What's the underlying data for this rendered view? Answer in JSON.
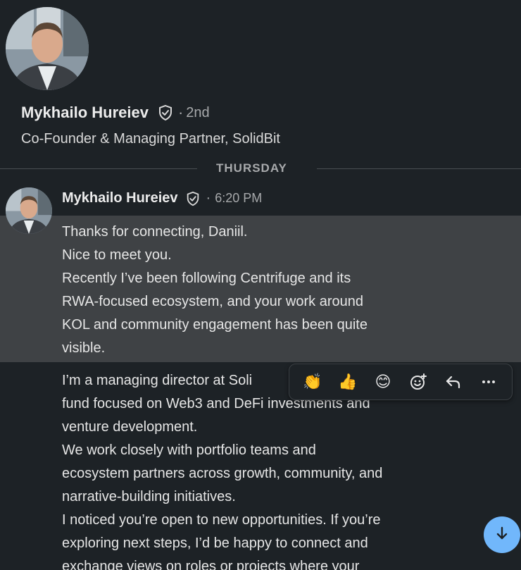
{
  "profile": {
    "name": "Mykhailo Hureiev",
    "degree_sep": "·",
    "degree": "2nd",
    "headline": "Co-Founder & Managing Partner, SolidBit"
  },
  "date_divider": "THURSDAY",
  "message": {
    "sender": "Mykhailo Hureiev",
    "separator": "·",
    "time": "6:20 PM",
    "highlighted_lines": [
      "Thanks for connecting, Daniil.",
      "Nice to meet you.",
      "Recently I’ve been following Centrifuge and its",
      "RWA-focused ecosystem, and your work around",
      "KOL and community engagement has been quite",
      "visible."
    ],
    "body_lines": [
      "I’m a managing director at Soli",
      "fund focused on Web3 and DeFi investments and",
      "venture development.",
      "We work closely with portfolio teams and",
      "ecosystem partners across growth, community, and",
      "narrative-building initiatives.",
      "I noticed you’re open to new opportunities. If you’re",
      "exploring next steps, I’d be happy to connect and",
      "exchange views on roles or projects where your"
    ]
  },
  "reactions": {
    "clap": "👏",
    "thumbs_up": "👍",
    "smile": "😊",
    "icons": [
      "clap-icon",
      "thumbs-up-icon",
      "smile-icon",
      "add-reaction-icon",
      "reply-icon",
      "more-icon"
    ]
  },
  "colors": {
    "background": "#1d2226",
    "highlight": "#3f4245",
    "accent_button": "#71b7fb",
    "text": "#e6e6e6",
    "muted": "#a7a9ab"
  }
}
